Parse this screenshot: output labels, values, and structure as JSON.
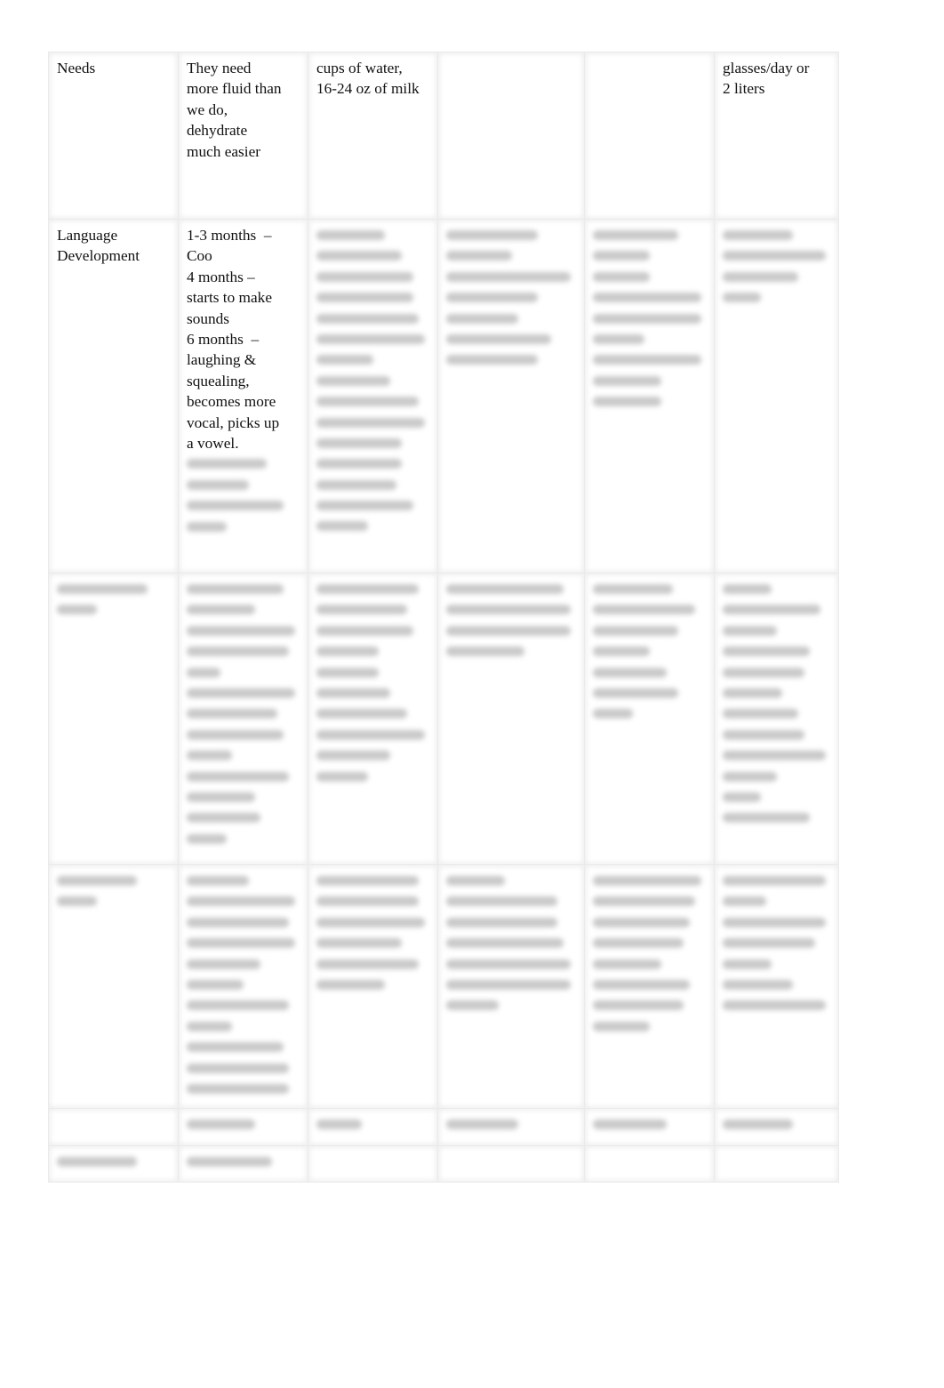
{
  "document": {
    "rows": [
      {
        "label": "Needs",
        "cells": [
          [
            "They need",
            "more fluid than",
            "we do,",
            "dehydrate",
            "much easier"
          ],
          [
            "cups of water,",
            "16-24 oz of milk"
          ],
          [],
          [],
          [
            "glasses/day or",
            "2 liters"
          ]
        ]
      },
      {
        "label_lines": [
          "Language",
          "Development"
        ],
        "cells_visible": [
          [
            "1-3 months  –",
            "Coo",
            "4 months –",
            "starts to make",
            "sounds",
            "6 months  –",
            "laughing &",
            "squealing,",
            "becomes more",
            "vocal, picks up",
            "a vowel."
          ]
        ],
        "blurred_note": "remaining content obscured"
      },
      {
        "label": "[blurred]",
        "blurred": true
      },
      {
        "label": "[blurred]",
        "blurred": true
      },
      {
        "label": "",
        "blurred": true
      },
      {
        "label": "[blurred]",
        "blurred": true
      }
    ]
  }
}
